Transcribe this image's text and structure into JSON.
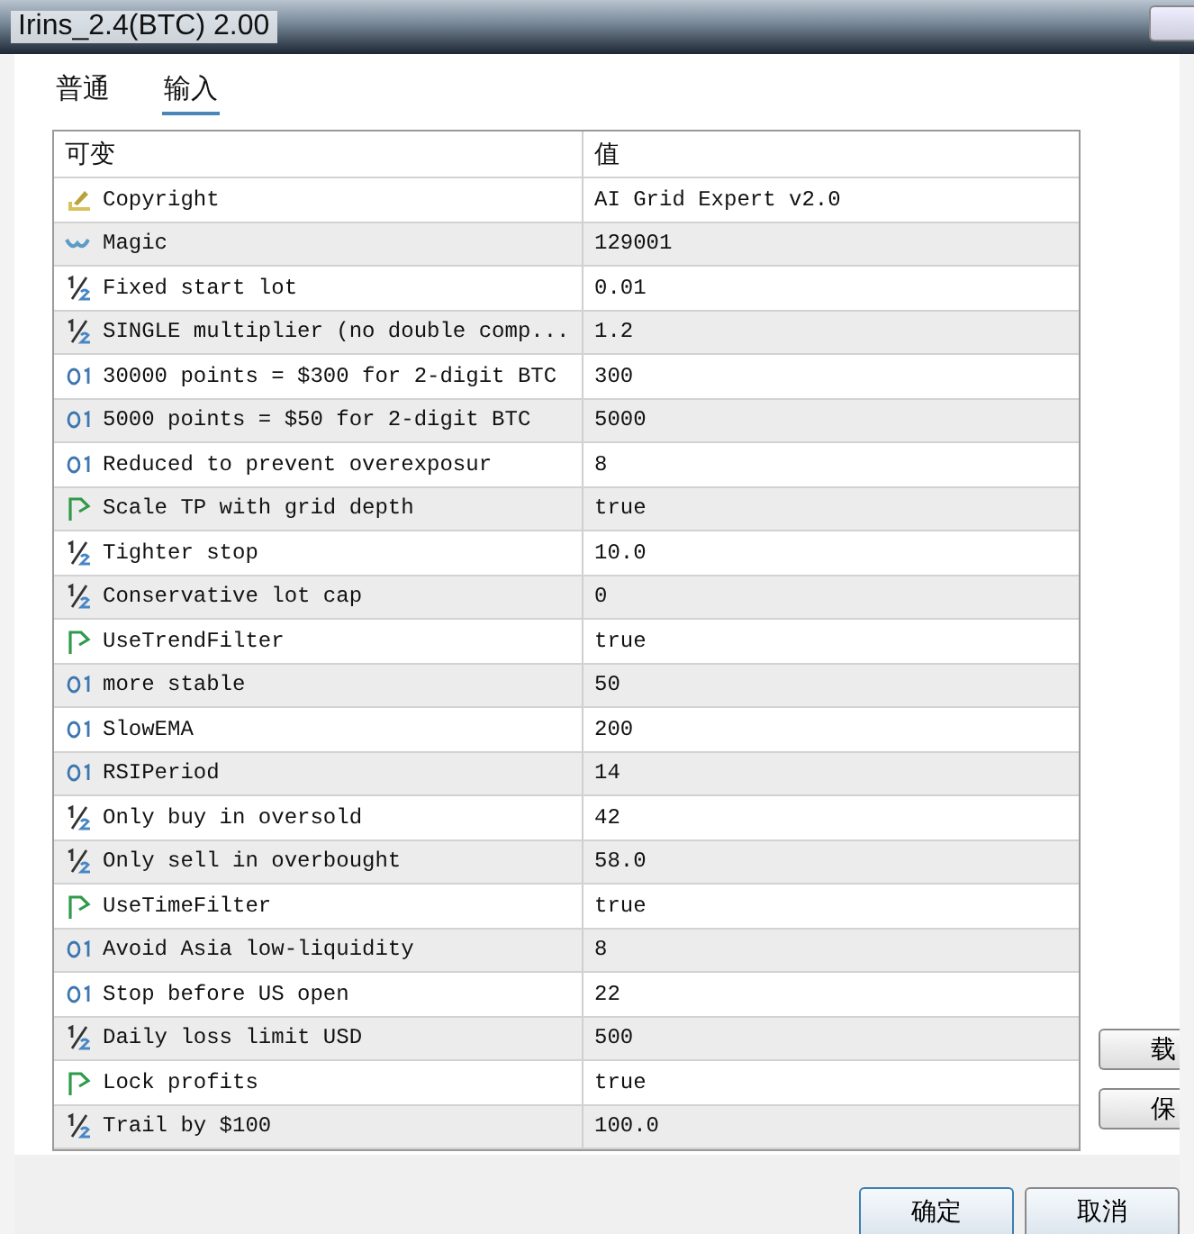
{
  "window": {
    "title": "Irins_2.4(BTC) 2.00"
  },
  "tabs": [
    {
      "label": "普通",
      "selected": false
    },
    {
      "label": "输入",
      "selected": true
    }
  ],
  "table": {
    "columns": [
      "可变",
      "值"
    ],
    "rows": [
      {
        "kind": "string",
        "name": "Copyright",
        "value": "AI Grid Expert v2.0"
      },
      {
        "kind": "magic",
        "name": "Magic",
        "value": "129001"
      },
      {
        "kind": "double",
        "name": "Fixed start lot",
        "value": "0.01"
      },
      {
        "kind": "double",
        "name": "SINGLE multiplier (no double comp...",
        "value": "1.2"
      },
      {
        "kind": "int",
        "name": "30000 points = $300 for 2-digit BTC",
        "value": "300"
      },
      {
        "kind": "int",
        "name": "5000 points = $50 for 2-digit BTC",
        "value": "5000"
      },
      {
        "kind": "int",
        "name": "Reduced to prevent overexposur",
        "value": "8"
      },
      {
        "kind": "bool",
        "name": "Scale TP with grid depth",
        "value": "true"
      },
      {
        "kind": "double",
        "name": "Tighter stop",
        "value": "10.0"
      },
      {
        "kind": "double",
        "name": "Conservative lot cap",
        "value": "0"
      },
      {
        "kind": "bool",
        "name": "UseTrendFilter",
        "value": "true"
      },
      {
        "kind": "int",
        "name": "more stable",
        "value": "50"
      },
      {
        "kind": "int",
        "name": "SlowEMA",
        "value": "200"
      },
      {
        "kind": "int",
        "name": "RSIPeriod",
        "value": "14"
      },
      {
        "kind": "double",
        "name": "Only buy in oversold",
        "value": "42"
      },
      {
        "kind": "double",
        "name": "Only sell in overbought",
        "value": "58.0"
      },
      {
        "kind": "bool",
        "name": "UseTimeFilter",
        "value": "true"
      },
      {
        "kind": "int",
        "name": "Avoid Asia low-liquidity",
        "value": "8"
      },
      {
        "kind": "int",
        "name": "Stop before US open",
        "value": "22"
      },
      {
        "kind": "double",
        "name": "Daily loss limit USD",
        "value": "500"
      },
      {
        "kind": "bool",
        "name": "Lock profits",
        "value": "true"
      },
      {
        "kind": "double",
        "name": "Trail by $100",
        "value": "100.0"
      }
    ]
  },
  "side_buttons": [
    "载",
    "保"
  ],
  "buttons": [
    "确定",
    "取消"
  ]
}
